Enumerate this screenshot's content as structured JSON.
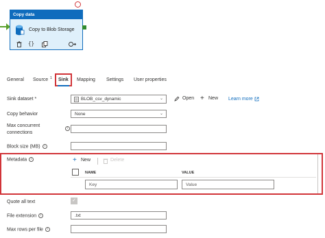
{
  "pipeline": {
    "activity_type": "Copy data",
    "activity_name": "Copy to Blob Storage"
  },
  "tabs": [
    {
      "label": "General"
    },
    {
      "label": "Source",
      "badge": "1"
    },
    {
      "label": "Sink"
    },
    {
      "label": "Mapping"
    },
    {
      "label": "Settings"
    },
    {
      "label": "User properties"
    }
  ],
  "active_tab": "Sink",
  "sink": {
    "dataset_label": "Sink dataset",
    "dataset_required": "*",
    "dataset_value": "BLOB_csv_dynamic",
    "open_label": "Open",
    "new_label": "New",
    "learn_more_label": "Learn more",
    "copy_behavior_label": "Copy behavior",
    "copy_behavior_value": "None",
    "max_connections_label_line1": "Max concurrent",
    "max_connections_label_line2": "connections",
    "max_connections_value": "",
    "block_size_label": "Block size (MB)",
    "block_size_value": ""
  },
  "metadata": {
    "label": "Metadata",
    "new_label": "New",
    "delete_label": "Delete",
    "col_name": "NAME",
    "col_value": "VALUE",
    "key_placeholder": "Key",
    "value_placeholder": "Value"
  },
  "format": {
    "quote_all_label": "Quote all text",
    "quote_all_checked": true,
    "file_ext_label": "File extension",
    "file_ext_value": ".txt",
    "max_rows_label": "Max rows per file",
    "max_rows_value": ""
  },
  "colors": {
    "accent": "#0f6cbd",
    "highlight": "#d13438",
    "success": "#5aa02c"
  },
  "icons": {
    "activity": "database-copy-icon",
    "open": "pencil-icon",
    "new": "plus-icon",
    "delete": "trash-icon",
    "external": "external-link-icon",
    "info": "info-icon",
    "dropdown": "chevron-down-icon"
  }
}
